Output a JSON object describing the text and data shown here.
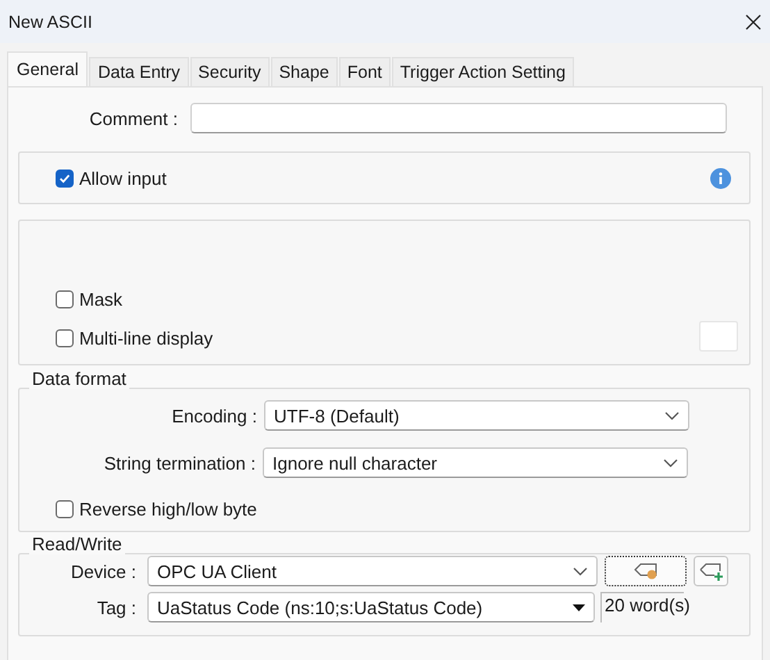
{
  "window": {
    "title": "New ASCII"
  },
  "tabs": [
    {
      "label": "General",
      "selected": true
    },
    {
      "label": "Data Entry",
      "selected": false
    },
    {
      "label": "Security",
      "selected": false
    },
    {
      "label": "Shape",
      "selected": false
    },
    {
      "label": "Font",
      "selected": false
    },
    {
      "label": "Trigger Action Setting",
      "selected": false
    }
  ],
  "comment": {
    "label": "Comment :"
  },
  "input_group": {
    "checkboxes": [
      {
        "label": "Allow input",
        "checked": true
      }
    ]
  },
  "display_group": {
    "checkboxes": [
      {
        "label": "Mask",
        "checked": false
      },
      {
        "label": "Multi-line display",
        "checked": false
      }
    ]
  },
  "data_format": {
    "title": "Data format",
    "fields": [
      {
        "label": "Encoding :",
        "value": "UTF-8 (Default)"
      },
      {
        "label": "String termination :",
        "value": "Ignore null character"
      }
    ],
    "checkboxes": [
      {
        "label": "Reverse high/low byte",
        "checked": false
      }
    ]
  },
  "read_write": {
    "title": "Read/Write",
    "fields": [
      {
        "label": "Device :",
        "value": "OPC UA Client",
        "kind": "chevron"
      },
      {
        "label": "Tag :",
        "value": "UaStatus Code (ns:10;s:UaStatus Code)",
        "kind": "triangle"
      }
    ],
    "size": "20 word(s)"
  }
}
